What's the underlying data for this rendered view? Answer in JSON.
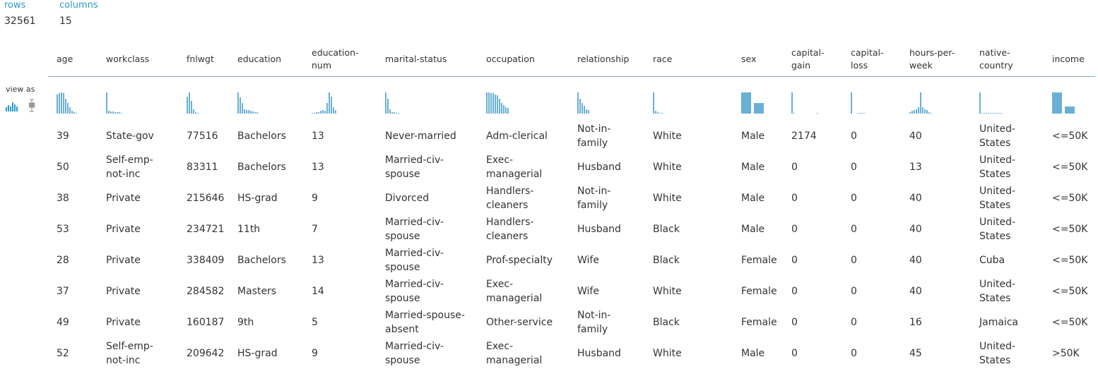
{
  "stats": {
    "rows_label": "rows",
    "rows_value": "32561",
    "columns_label": "columns",
    "columns_value": "15"
  },
  "view_as": {
    "label": "view as",
    "icons": [
      "histogram-icon",
      "boxplot-icon"
    ]
  },
  "accent_color": "#2b9bc4",
  "bar_color": "#6ab0d4",
  "columns": [
    {
      "name": "age",
      "label": "age",
      "hist": [
        0.9,
        0.95,
        1.0,
        0.95,
        0.7,
        0.5,
        0.3,
        0.12,
        0.06,
        0.03
      ],
      "hist_style": "narrow"
    },
    {
      "name": "workclass",
      "label": "workclass",
      "hist": [
        1.0,
        0.12,
        0.1,
        0.1,
        0.08,
        0.08,
        0.08,
        0.02
      ],
      "hist_style": "narrow"
    },
    {
      "name": "fnlwgt",
      "label": "fnlwgt",
      "hist": [
        0.8,
        1.0,
        0.6,
        0.2,
        0.05,
        0.02
      ],
      "hist_style": "narrow"
    },
    {
      "name": "education",
      "label": "education",
      "hist": [
        1.0,
        0.75,
        0.5,
        0.2,
        0.15,
        0.15,
        0.12,
        0.1,
        0.08,
        0.08
      ],
      "hist_style": "narrow"
    },
    {
      "name": "education-num",
      "label": "education-\nnum",
      "hist": [
        0.02,
        0.04,
        0.06,
        0.08,
        0.12,
        0.15,
        0.12,
        0.5,
        1.0,
        0.8,
        0.3,
        0.15
      ],
      "hist_style": "narrow"
    },
    {
      "name": "marital-status",
      "label": "marital-status",
      "hist": [
        1.0,
        0.7,
        0.2,
        0.08,
        0.06,
        0.04,
        0.02
      ],
      "hist_style": "narrow"
    },
    {
      "name": "occupation",
      "label": "occupation",
      "hist": [
        1.0,
        1.0,
        0.98,
        0.95,
        0.9,
        0.85,
        0.7,
        0.5,
        0.4,
        0.3,
        0.25
      ],
      "hist_style": "narrow"
    },
    {
      "name": "relationship",
      "label": "relationship",
      "hist": [
        1.0,
        0.7,
        0.5,
        0.35,
        0.2,
        0.15
      ],
      "hist_style": "narrow"
    },
    {
      "name": "race",
      "label": "race",
      "hist": [
        1.0,
        0.12,
        0.08,
        0.03,
        0.03
      ],
      "hist_style": "narrow"
    },
    {
      "name": "sex",
      "label": "sex",
      "hist": [
        1.0,
        0.5
      ],
      "hist_style": "wide"
    },
    {
      "name": "capital-gain",
      "label": "capital-\ngain",
      "hist": [
        1.0,
        0.02,
        0,
        0,
        0,
        0,
        0,
        0,
        0,
        0,
        0,
        0,
        0.02
      ],
      "hist_style": "narrow"
    },
    {
      "name": "capital-loss",
      "label": "capital-\nloss",
      "hist": [
        1.0,
        0,
        0,
        0.02,
        0.02,
        0.02,
        0.02
      ],
      "hist_style": "narrow"
    },
    {
      "name": "hours-per-week",
      "label": "hours-per-\nweek",
      "hist": [
        0.06,
        0.12,
        0.15,
        0.2,
        0.3,
        1.0,
        0.3,
        0.2,
        0.15,
        0.05,
        0.03
      ],
      "hist_style": "narrow"
    },
    {
      "name": "native-country",
      "label": "native-\ncountry",
      "hist": [
        1.0,
        0.03,
        0.03,
        0.03,
        0.03,
        0.03,
        0.03,
        0.03,
        0.03,
        0.03,
        0.03
      ],
      "hist_style": "narrow"
    },
    {
      "name": "income",
      "label": "income",
      "hist": [
        1.0,
        0.32
      ],
      "hist_style": "wide"
    }
  ],
  "rows": [
    [
      "39",
      "State-gov",
      "77516",
      "Bachelors",
      "13",
      "Never-married",
      "Adm-clerical",
      "Not-in-\nfamily",
      "White",
      "Male",
      "2174",
      "0",
      "40",
      "United-\nStates",
      "<=50K"
    ],
    [
      "50",
      "Self-emp-\nnot-inc",
      "83311",
      "Bachelors",
      "13",
      "Married-civ-\nspouse",
      "Exec-\nmanagerial",
      "Husband",
      "White",
      "Male",
      "0",
      "0",
      "13",
      "United-\nStates",
      "<=50K"
    ],
    [
      "38",
      "Private",
      "215646",
      "HS-grad",
      "9",
      "Divorced",
      "Handlers-\ncleaners",
      "Not-in-\nfamily",
      "White",
      "Male",
      "0",
      "0",
      "40",
      "United-\nStates",
      "<=50K"
    ],
    [
      "53",
      "Private",
      "234721",
      "11th",
      "7",
      "Married-civ-\nspouse",
      "Handlers-\ncleaners",
      "Husband",
      "Black",
      "Male",
      "0",
      "0",
      "40",
      "United-\nStates",
      "<=50K"
    ],
    [
      "28",
      "Private",
      "338409",
      "Bachelors",
      "13",
      "Married-civ-\nspouse",
      "Prof-specialty",
      "Wife",
      "Black",
      "Female",
      "0",
      "0",
      "40",
      "Cuba",
      "<=50K"
    ],
    [
      "37",
      "Private",
      "284582",
      "Masters",
      "14",
      "Married-civ-\nspouse",
      "Exec-\nmanagerial",
      "Wife",
      "White",
      "Female",
      "0",
      "0",
      "40",
      "United-\nStates",
      "<=50K"
    ],
    [
      "49",
      "Private",
      "160187",
      "9th",
      "5",
      "Married-spouse-\nabsent",
      "Other-service",
      "Not-in-\nfamily",
      "Black",
      "Female",
      "0",
      "0",
      "16",
      "Jamaica",
      "<=50K"
    ],
    [
      "52",
      "Self-emp-\nnot-inc",
      "209642",
      "HS-grad",
      "9",
      "Married-civ-\nspouse",
      "Exec-\nmanagerial",
      "Husband",
      "White",
      "Male",
      "0",
      "0",
      "45",
      "United-\nStates",
      ">50K"
    ]
  ]
}
